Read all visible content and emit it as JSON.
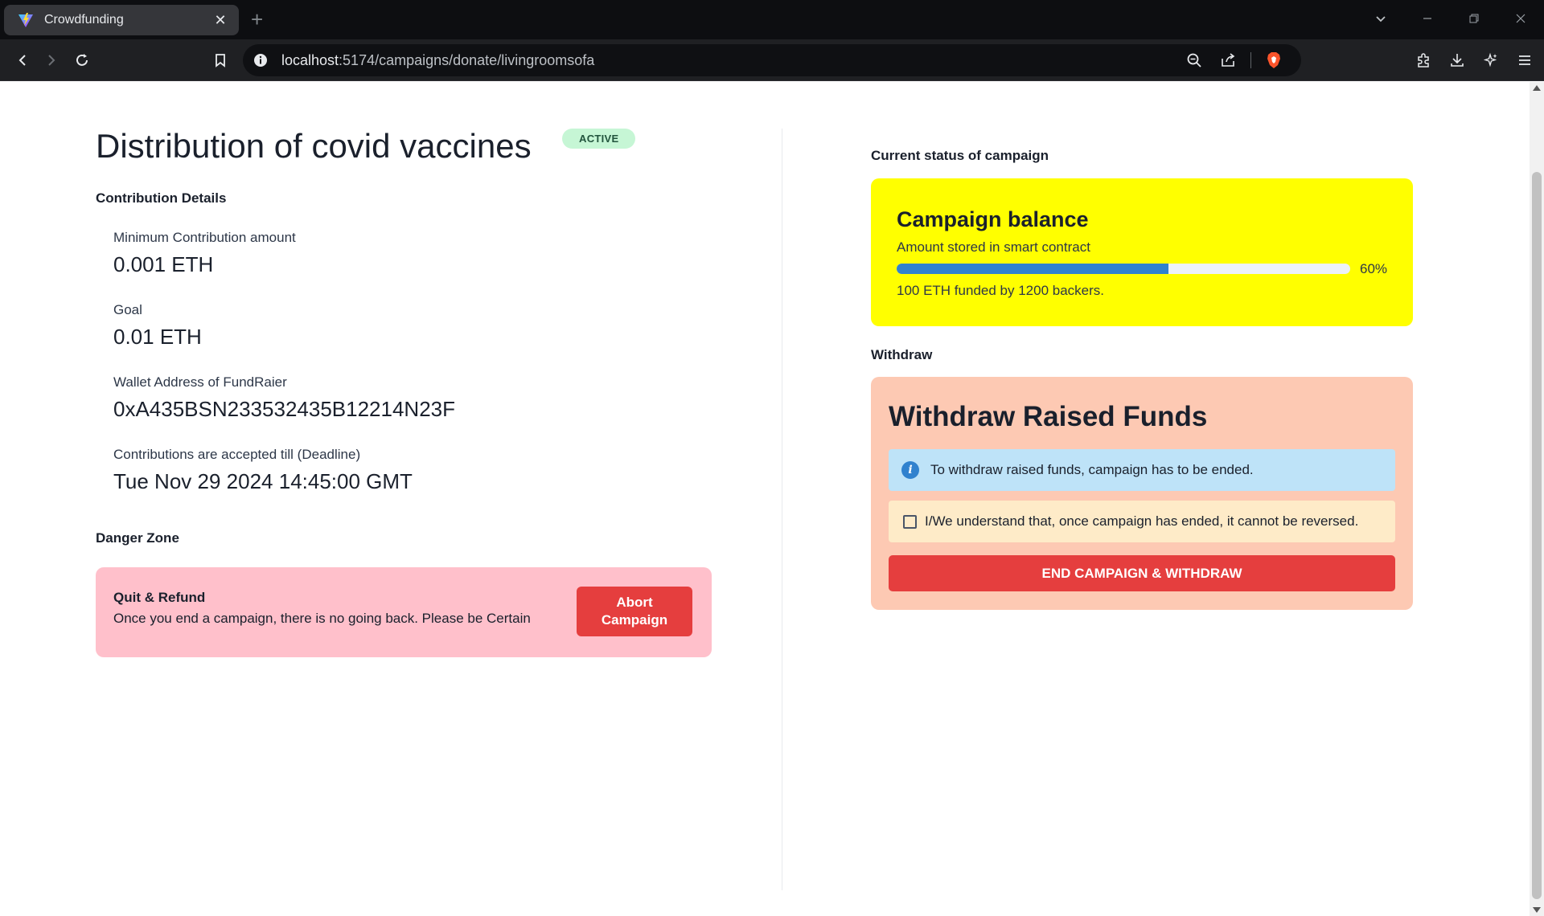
{
  "browser": {
    "tab_title": "Crowdfunding",
    "tab_close": "✕",
    "new_tab": "+",
    "url_host": "localhost",
    "url_rest": ":5174/campaigns/donate/livingroomsofa"
  },
  "campaign": {
    "title": "Distribution of covid vaccines",
    "status": "ACTIVE",
    "contribution_heading": "Contribution Details",
    "details": [
      {
        "label": "Minimum Contribution amount",
        "value": "0.001 ETH"
      },
      {
        "label": "Goal",
        "value": "0.01 ETH"
      },
      {
        "label": "Wallet Address of FundRaier",
        "value": "0xA435BSN233532435B12214N23F"
      },
      {
        "label": "Contributions are accepted till (Deadline)",
        "value": "Tue Nov 29 2024 14:45:00 GMT"
      }
    ],
    "danger_heading": "Danger Zone",
    "danger": {
      "title": "Quit & Refund",
      "text": "Once you end a campaign, there is no going back. Please be Certain",
      "button": "Abort Campaign"
    }
  },
  "status_panel": {
    "heading": "Current status of campaign",
    "balance_title": "Campaign balance",
    "balance_sub": "Amount stored in smart contract",
    "progress_percent": 60,
    "progress_label": "60%",
    "funded_text": "100 ETH funded by 1200 backers."
  },
  "withdraw_panel": {
    "heading": "Withdraw",
    "title": "Withdraw Raised Funds",
    "info_text": "To withdraw raised funds, campaign has to be ended.",
    "confirm_text": "I/We understand that, once campaign has ended, it cannot be reversed.",
    "button": "END CAMPAIGN & WITHDRAW"
  },
  "colors": {
    "balance_card": "#ffff00",
    "withdraw_card": "#fdc9b3",
    "danger_card": "#ffc0cb",
    "button_red": "#e53e3e",
    "progress": "#3182ce",
    "badge": "#c6f6d5"
  }
}
